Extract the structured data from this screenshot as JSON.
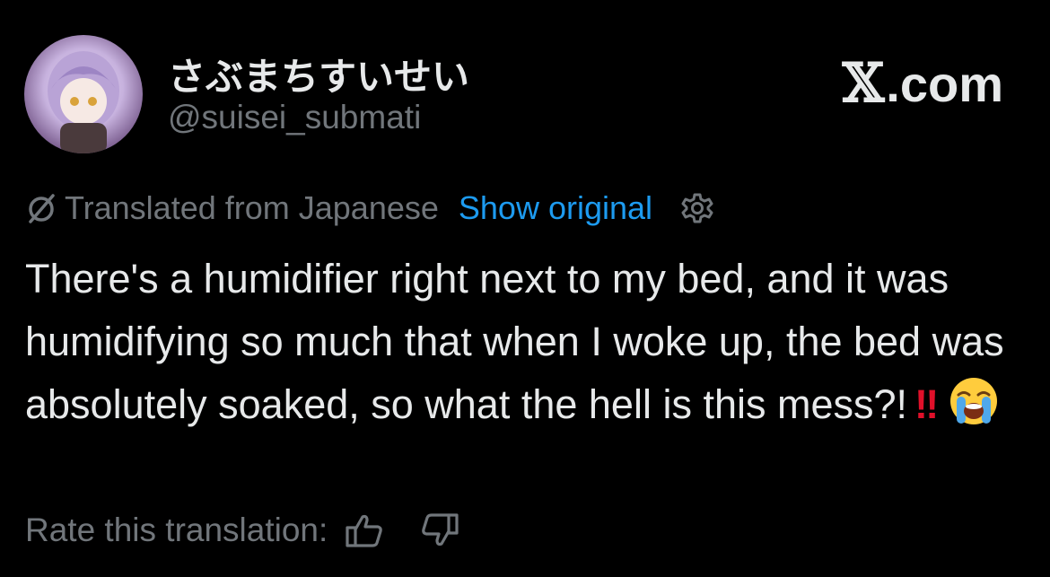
{
  "post": {
    "display_name": "さぶまちすいせい",
    "handle": "@suisei_submati",
    "avatar_icon": "avatar-anime-character",
    "brand_x": "𝕏",
    "brand_domain": ".com",
    "translation": {
      "translated_from": "Translated from Japanese",
      "show_original": "Show original",
      "translate_icon": "translate-slash-icon",
      "settings_icon": "gear-icon"
    },
    "text": "There's a humidifier right next to my bed, and it was humidifying so much that when I woke up, the bed was absolutely soaked, so what the hell is this mess?!",
    "text_bang": "‼",
    "text_emoji": "loudly-crying-face",
    "rate": {
      "label": "Rate this translation:",
      "thumbs_up_icon": "thumbs-up-icon",
      "thumbs_down_icon": "thumbs-down-icon"
    }
  },
  "colors": {
    "background": "#000000",
    "primary_text": "#e7e9ea",
    "secondary_text": "#71767b",
    "link": "#1d9bf0",
    "bang": "#e0102a"
  }
}
